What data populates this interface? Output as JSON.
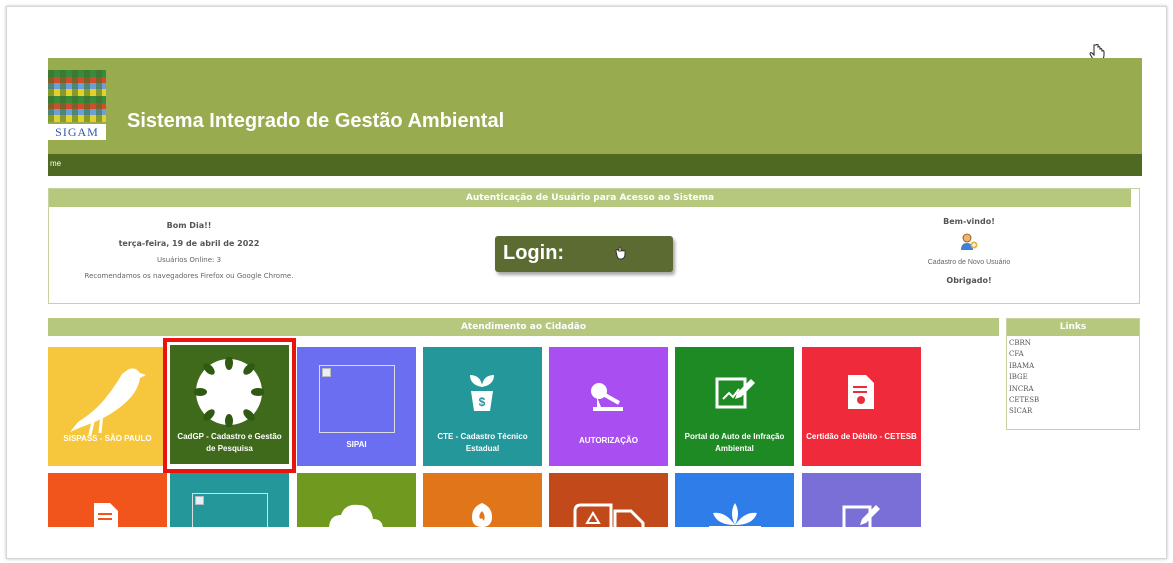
{
  "colors": {
    "header_bg": "#98ab4e",
    "nav_bg": "#4f6922",
    "bar_bg": "#b6c77e",
    "highlight": "#e8150d"
  },
  "header": {
    "logo_text": "SIGAM",
    "title": "Sistema Integrado de Gestão Ambiental",
    "nav_text": "me"
  },
  "auth": {
    "bar_title": "Autenticação de Usuário para Acesso ao Sistema",
    "greeting": "Bom Dia!!",
    "date": "terça-feira, 19 de abril de 2022",
    "online_users": "Usuários Online: 3",
    "browser_tip": "Recomendamos os navegadores Firefox ou Google Chrome.",
    "login_label": "Login:",
    "login_icon": "pointer-hand-icon",
    "welcome": "Bem-vindo!",
    "new_user_icon": "new-user-icon",
    "new_user_link": "Cadastro de Novo Usuário",
    "thanks": "Obrigado!"
  },
  "services": {
    "bar_title": "Atendimento ao Cidadão",
    "tiles": [
      {
        "label": "SISPASS - SÃO PAULO",
        "icon": "bird-icon",
        "color": "#f6c63d"
      },
      {
        "label": "CadGP - Cadastro e Gestão de Pesquisa",
        "icon": "leaf-wreath-icon",
        "color": "#3f6a1b"
      },
      {
        "label": "SIPAI",
        "icon": "broken-image-icon",
        "color": "#6b6ef0"
      },
      {
        "label": "CTE - Cadastro Técnico Estadual",
        "icon": "plant-money-icon",
        "color": "#24979b"
      },
      {
        "label": "AUTORIZAÇÃO",
        "icon": "stamp-icon",
        "color": "#a94ff2"
      },
      {
        "label": "Portal do Auto de Infração Ambiental",
        "icon": "edit-document-icon",
        "color": "#1e8a24"
      },
      {
        "label": "Certidão de Débito - CETESB",
        "icon": "certificate-icon",
        "color": "#ee2a3b"
      },
      {
        "label": "",
        "icon": "document-icon",
        "color": "#f2551c"
      },
      {
        "label": "",
        "icon": "broken-image-icon",
        "color": "#24979b"
      },
      {
        "label": "",
        "icon": "cloud-icon",
        "color": "#6f9a1f"
      },
      {
        "label": "",
        "icon": "tree-fire-icon",
        "color": "#e0751a"
      },
      {
        "label": "",
        "icon": "truck-icon",
        "color": "#c24a1a"
      },
      {
        "label": "",
        "icon": "lotus-icon",
        "color": "#2f7de8"
      },
      {
        "label": "",
        "icon": "edit-document-icon",
        "color": "#7a6fd6"
      }
    ]
  },
  "links": {
    "title": "Links",
    "items": [
      "CBRN",
      "CFA",
      "IBAMA",
      "IBGE",
      "INCRA",
      "CETESB",
      "SICAR"
    ]
  }
}
